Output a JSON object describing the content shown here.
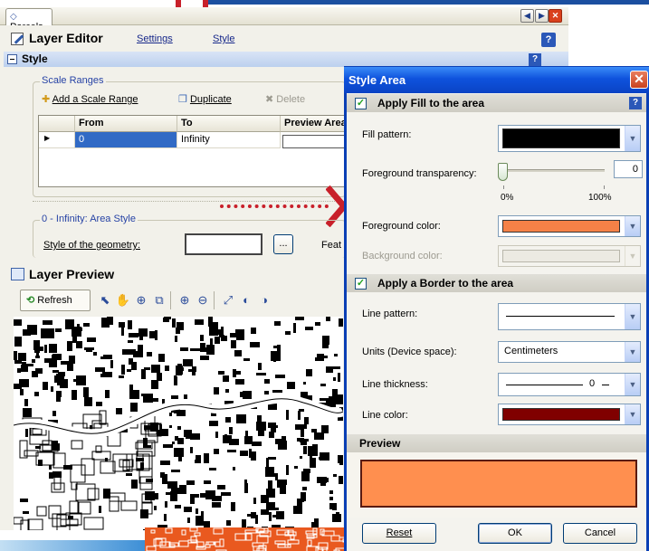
{
  "colors": {
    "accent": "#0a43c4",
    "fill_preview": "#ff8f4f",
    "foreground": "#f58147",
    "line": "#800000",
    "fill_pattern": "#000000"
  },
  "tab": {
    "label": "Parcels"
  },
  "editor": {
    "title": "Layer Editor",
    "settings": "Settings",
    "style": "Style"
  },
  "style_section": {
    "label": "Style"
  },
  "scale_ranges": {
    "legend": "Scale Ranges",
    "add": "Add a Scale Range",
    "duplicate": "Duplicate",
    "delete": "Delete",
    "columns": [
      "From",
      "To",
      "Preview Area"
    ],
    "rows": [
      {
        "from": "0",
        "to": "Infinity"
      }
    ]
  },
  "area_style": {
    "legend": "0 - Infinity: Area Style",
    "style_of_geometry": "Style of the geometry:",
    "ellipsis": "...",
    "feat": "Feat"
  },
  "preview": {
    "title": "Layer Preview",
    "refresh": "Refresh"
  },
  "dialog": {
    "title": "Style Area",
    "fill_section": "Apply Fill to the area",
    "fill_pattern": "Fill pattern:",
    "fg_transparency": "Foreground transparency:",
    "transparency_value": "0",
    "min": "0%",
    "max": "100%",
    "fg_color": "Foreground color:",
    "bg_color": "Background color:",
    "border_section": "Apply a Border to the area",
    "line_pattern": "Line pattern:",
    "units": "Units (Device space):",
    "units_value": "Centimeters",
    "line_thickness": "Line thickness:",
    "thickness_value": "0",
    "line_color": "Line color:",
    "preview": "Preview",
    "reset": "Reset",
    "ok": "OK",
    "cancel": "Cancel"
  }
}
